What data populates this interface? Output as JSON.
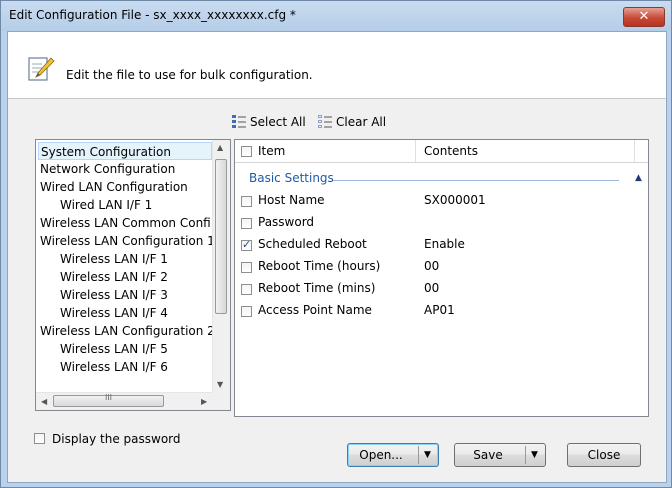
{
  "window": {
    "title": "Edit Configuration File - sx_xxxx_xxxxxxxx.cfg *",
    "close_glyph": "✕"
  },
  "header": {
    "instruction": "Edit the file to use for bulk configuration.",
    "icon": "edit-document-icon"
  },
  "toolbar": {
    "select_all": "Select All",
    "clear_all": "Clear All"
  },
  "tree": {
    "items": [
      {
        "label": "System Configuration",
        "indent": 0,
        "selected": true
      },
      {
        "label": "Network Configuration",
        "indent": 0
      },
      {
        "label": "Wired LAN Configuration",
        "indent": 0
      },
      {
        "label": "Wired LAN I/F 1",
        "indent": 1
      },
      {
        "label": "Wireless LAN Common Confi",
        "indent": 0
      },
      {
        "label": "Wireless LAN Configuration 1",
        "indent": 0
      },
      {
        "label": "Wireless LAN I/F 1",
        "indent": 1
      },
      {
        "label": "Wireless LAN I/F 2",
        "indent": 1
      },
      {
        "label": "Wireless LAN I/F 3",
        "indent": 1
      },
      {
        "label": "Wireless LAN I/F 4",
        "indent": 1
      },
      {
        "label": "Wireless LAN Configuration 2",
        "indent": 0
      },
      {
        "label": "Wireless LAN I/F 5",
        "indent": 1
      },
      {
        "label": "Wireless LAN I/F 6",
        "indent": 1
      }
    ],
    "hscroll_grip": "III"
  },
  "grid": {
    "headers": {
      "item": "Item",
      "contents": "Contents"
    },
    "group": "Basic Settings",
    "rows": [
      {
        "name": "Host Name",
        "value": "SX000001",
        "checked": false
      },
      {
        "name": "Password",
        "value": "",
        "checked": false
      },
      {
        "name": "Scheduled Reboot",
        "value": "Enable",
        "checked": true
      },
      {
        "name": "Reboot Time (hours)",
        "value": "00",
        "checked": false
      },
      {
        "name": "Reboot Time (mins)",
        "value": "00",
        "checked": false
      },
      {
        "name": "Access Point Name",
        "value": "AP01",
        "checked": false
      }
    ]
  },
  "footer": {
    "display_password": "Display the password",
    "open": "Open...",
    "save": "Save",
    "close": "Close"
  },
  "colors": {
    "accent": "#1e5ba8",
    "titlebar": "#b9d1ea",
    "close_button": "#c74a36"
  }
}
